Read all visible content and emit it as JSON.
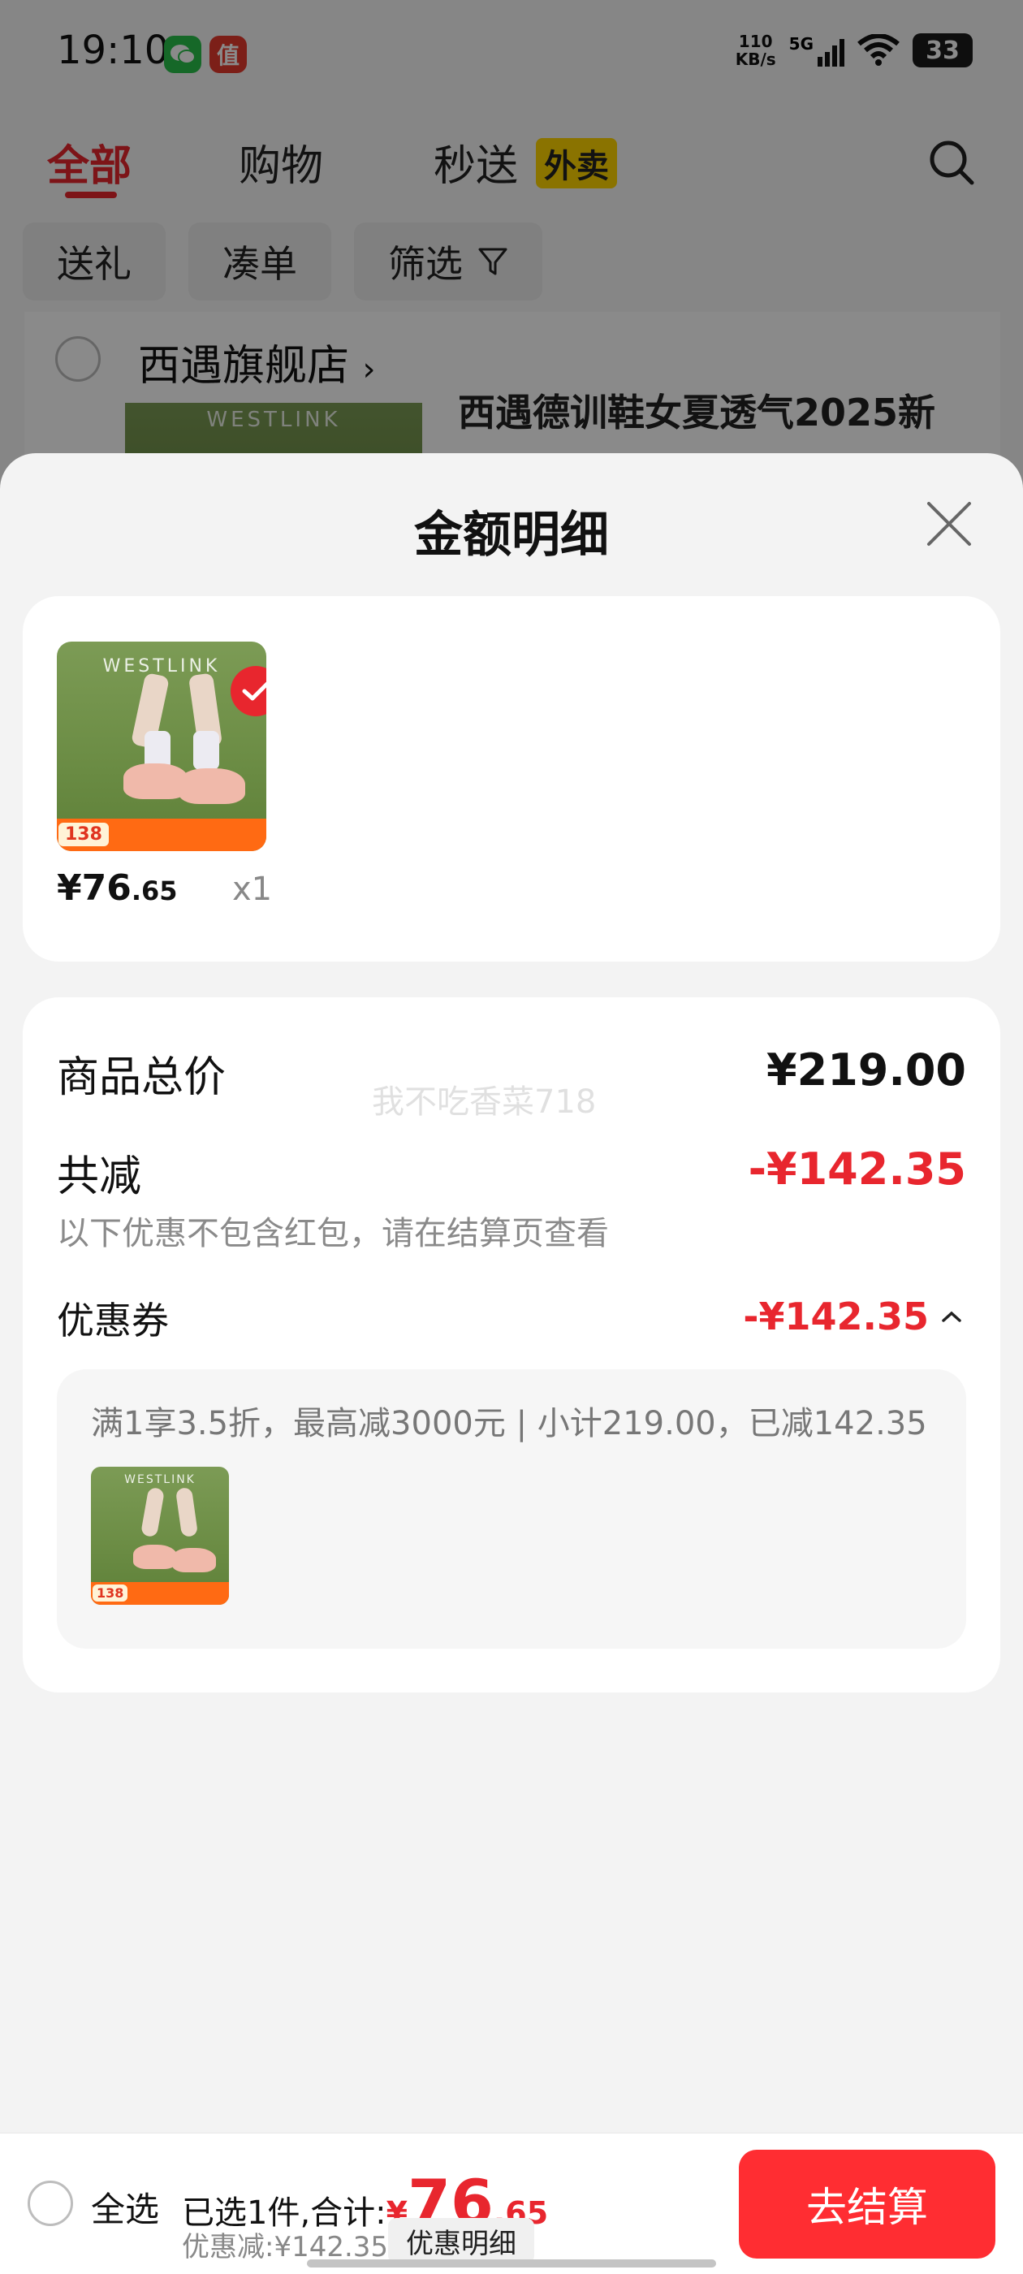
{
  "status_bar": {
    "time": "19:10",
    "net_speed_value": "110",
    "net_speed_unit": "KB/s",
    "signal_label": "5G",
    "battery": "33",
    "icons": [
      "wechat-icon",
      "app-zhi-icon",
      "signal-icon",
      "wifi-icon",
      "battery-icon"
    ]
  },
  "tabs": [
    {
      "label": "全部",
      "active": true
    },
    {
      "label": "购物",
      "active": false
    },
    {
      "label": "秒送",
      "active": false
    }
  ],
  "waimai_badge": "外卖",
  "filters": [
    "送礼",
    "凑单",
    "筛选"
  ],
  "store": {
    "name": "西遇旗舰店",
    "chevron": "›",
    "product_title": "西遇德训鞋女夏透气2025新"
  },
  "sheet": {
    "title": "金额明细",
    "product": {
      "brand": "WESTLINK",
      "price_int": "¥76",
      "price_dec": ".65",
      "qty": "x1"
    },
    "total_label": "商品总价",
    "total_value": "¥219.00",
    "watermark": "我不吃香菜718",
    "reduce_label": "共减",
    "reduce_value": "-¥142.35",
    "reduce_note": "以下优惠不包含红包，请在结算页查看",
    "coupon_label": "优惠券",
    "coupon_value": "-¥142.35",
    "coupon_rule": "满1享3.5折，最高减3000元 | 小计219.00，已减142.35",
    "coupon_item_brand": "WESTLINK",
    "coupon_item_price": "138"
  },
  "checkout": {
    "select_all": "全选",
    "selected_prefix": "已选1件,合计:",
    "currency": "¥",
    "total_int": "76",
    "total_dec": ".65",
    "discount_text": "优惠减:¥142.35",
    "discount_detail_button": "优惠明细",
    "checkout_button": "去结算"
  },
  "colors": {
    "accent_red": "#e8262e",
    "checkout_red": "#ff2d32",
    "waimai_yellow": "#ffd400"
  }
}
